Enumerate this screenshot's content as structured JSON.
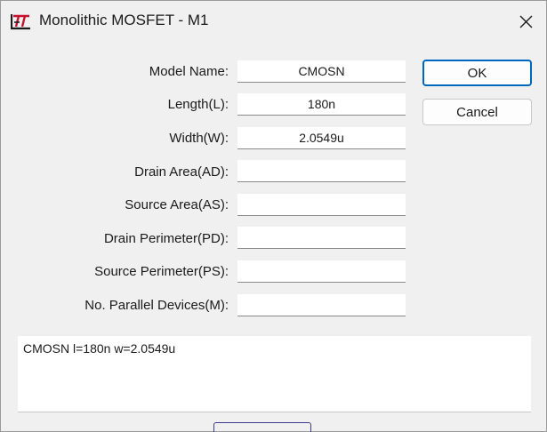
{
  "window": {
    "title": "Monolithic MOSFET - M1",
    "icon": "ltspice-logo-icon",
    "close_icon": "close-icon"
  },
  "fields": [
    {
      "label": "Model Name:",
      "value": "CMOSN"
    },
    {
      "label": "Length(L):",
      "value": "180n"
    },
    {
      "label": "Width(W):",
      "value": "2.0549u"
    },
    {
      "label": "Drain Area(AD):",
      "value": ""
    },
    {
      "label": "Source Area(AS):",
      "value": ""
    },
    {
      "label": "Drain Perimeter(PD):",
      "value": ""
    },
    {
      "label": "Source Perimeter(PS):",
      "value": ""
    },
    {
      "label": "No. Parallel Devices(M):",
      "value": ""
    }
  ],
  "buttons": {
    "ok_label": "OK",
    "cancel_label": "Cancel"
  },
  "netlist": {
    "text": "CMOSN l=180n w=2.0549u"
  },
  "colors": {
    "dialog_bg": "#f0f0f0",
    "focus_accent": "#0067c0",
    "logo_red": "#c8102e"
  }
}
